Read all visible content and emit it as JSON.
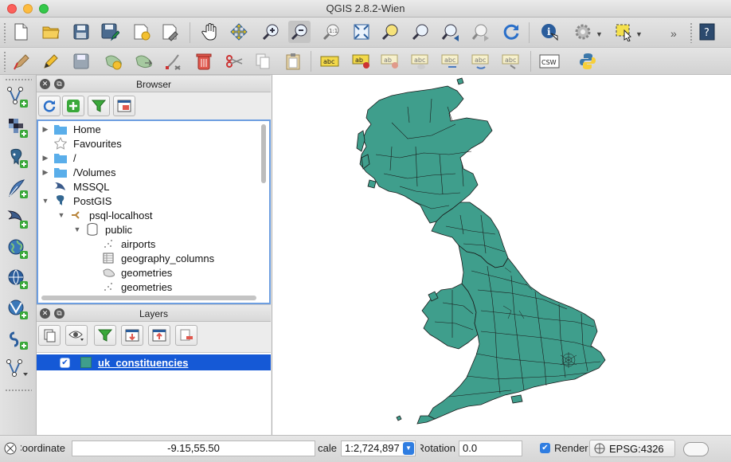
{
  "window": {
    "title": "QGIS 2.8.2-Wien"
  },
  "toolbar_main": {
    "icons": [
      "new-project-icon",
      "open-project-icon",
      "save-project-icon",
      "save-as-icon",
      "new-print-composer-icon",
      "composer-manager-icon",
      "pan-icon",
      "pan-to-selection-icon",
      "zoom-in-icon",
      "zoom-out-icon",
      "zoom-native-icon",
      "zoom-full-icon",
      "zoom-to-selection-icon",
      "zoom-to-layer-icon",
      "zoom-last-icon",
      "zoom-next-icon",
      "refresh-icon",
      "identify-icon",
      "action-icon",
      "select-icon",
      "more-icon",
      "help-icon"
    ]
  },
  "toolbar_edit": {
    "icons": [
      "current-edits-icon",
      "toggle-editing-icon",
      "save-edits-icon",
      "add-feature-icon",
      "move-feature-icon",
      "node-tool-icon",
      "delete-selected-icon",
      "cut-icon",
      "copy-icon",
      "paste-icon",
      "label-icon",
      "pin-label-icon",
      "show-hide-labels-icon",
      "move-label-icon",
      "rotate-label-icon",
      "change-label-icon",
      "csw-icon",
      "python-console-icon"
    ],
    "csw_label": "CSW"
  },
  "left_toolbar": {
    "icons": [
      "add-vector-layer-icon",
      "add-raster-layer-icon",
      "add-postgis-layer-icon",
      "add-spatialite-layer-icon",
      "add-mssql-layer-icon",
      "add-wms-layer-icon",
      "add-wcs-layer-icon",
      "add-wfs-layer-icon",
      "add-delimited-text-icon",
      "new-shapefile-icon"
    ]
  },
  "browser": {
    "title": "Browser",
    "tools": [
      "refresh-icon",
      "add-selected-icon",
      "filter-icon",
      "collapse-all-icon"
    ],
    "items": [
      {
        "label": "Home",
        "icon": "folder-icon",
        "expand": "collapsed",
        "depth": 0
      },
      {
        "label": "Favourites",
        "icon": "star-icon",
        "expand": "none",
        "depth": 0
      },
      {
        "label": "/",
        "icon": "folder-icon",
        "expand": "collapsed",
        "depth": 0
      },
      {
        "label": "/Volumes",
        "icon": "folder-icon",
        "expand": "collapsed",
        "depth": 0
      },
      {
        "label": "MSSQL",
        "icon": "mssql-icon",
        "expand": "none",
        "depth": 0
      },
      {
        "label": "PostGIS",
        "icon": "postgis-icon",
        "expand": "expanded",
        "depth": 0
      },
      {
        "label": "psql-localhost",
        "icon": "connection-icon",
        "expand": "expanded",
        "depth": 1
      },
      {
        "label": "public",
        "icon": "database-schema-icon",
        "expand": "expanded",
        "depth": 2
      },
      {
        "label": "airports",
        "icon": "point-layer-icon",
        "expand": "none",
        "depth": 3
      },
      {
        "label": "geography_columns",
        "icon": "table-icon",
        "expand": "none",
        "depth": 3
      },
      {
        "label": "geometries",
        "icon": "polygon-layer-icon",
        "expand": "none",
        "depth": 3
      },
      {
        "label": "geometries",
        "icon": "point-layer-icon",
        "expand": "none",
        "depth": 3
      }
    ]
  },
  "layers": {
    "title": "Layers",
    "tools": [
      "add-group-icon",
      "manage-visibility-icon",
      "filter-legend-icon",
      "expand-all-icon",
      "collapse-all-icon",
      "remove-layer-icon"
    ],
    "items": [
      {
        "name": "uk_constituencies",
        "checked": true,
        "selected": true,
        "color": "#3f9e8c"
      }
    ]
  },
  "map": {
    "fill_color": "#3f9e8c",
    "stroke_color": "#1a1a1a"
  },
  "statusbar": {
    "coordinate_label": "Coordinate",
    "coordinate_value": "-9.15,55.50",
    "scale_label": "Scale",
    "scale_value": "1:2,724,897",
    "rotation_label": "Rotation",
    "rotation_value": "0.0",
    "render_label": "Render",
    "render_checked": true,
    "crs_label": "EPSG:4326"
  }
}
